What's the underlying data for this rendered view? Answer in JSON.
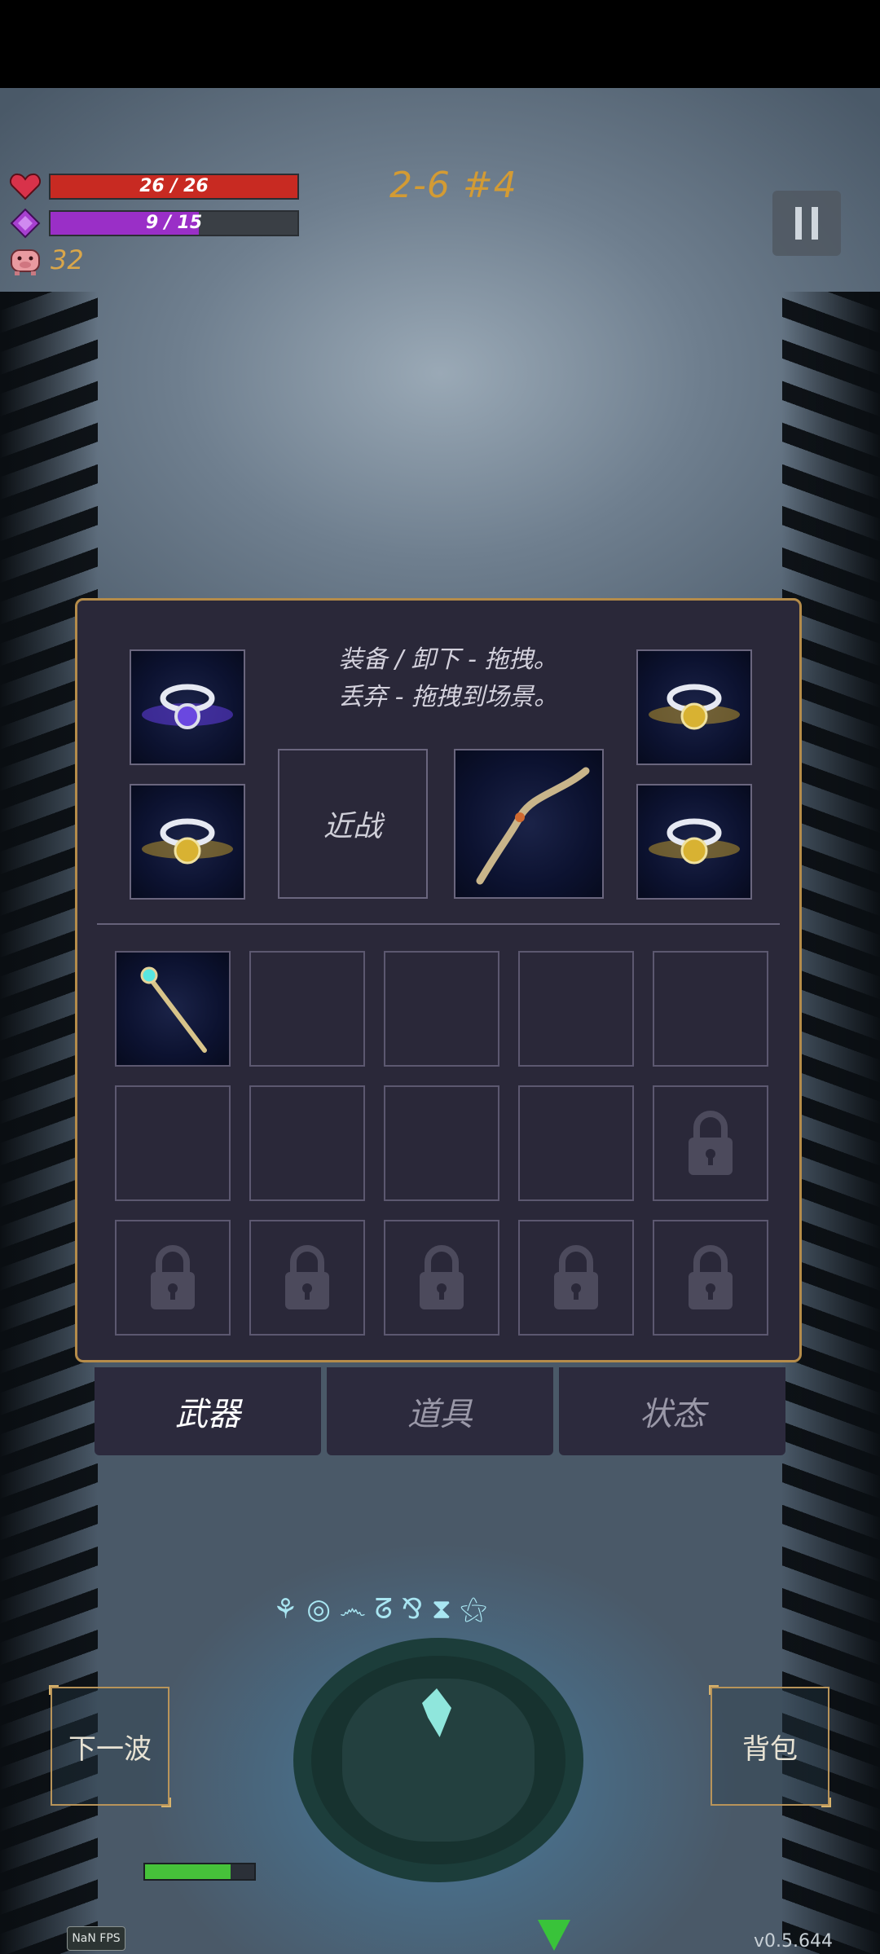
{
  "hud": {
    "hp_text": "26 / 26",
    "hp_fraction": 1.0,
    "mp_text": "9 / 15",
    "mp_fraction": 0.6,
    "coins": "32",
    "stage": "2-6 #4"
  },
  "inventory": {
    "hint_line1": "装备 / 卸下 - 拖拽。",
    "hint_line2": "丢弃 - 拖拽到场景。",
    "melee_slot_label": "近战",
    "equipped_icons": [
      "ring-purple-icon",
      "ring-gold-icon",
      "ring-gold-icon",
      "ring-gold-icon",
      "bow-icon"
    ],
    "grid_row1_first_item": "staff-icon",
    "locked_slots": 6
  },
  "tabs": {
    "weapons": "武器",
    "items": "道具",
    "status": "状态",
    "active": "weapons"
  },
  "buttons": {
    "next_wave": "下一波",
    "backpack": "背包"
  },
  "footer": {
    "fps": "NaN FPS",
    "version": "v0.5.644"
  },
  "colors": {
    "hp": "#c82a22",
    "mp": "#9a2fc7",
    "accent_gold": "#b58c4a",
    "stage_text": "#d39b34",
    "panel_bg": "#2a2839"
  }
}
